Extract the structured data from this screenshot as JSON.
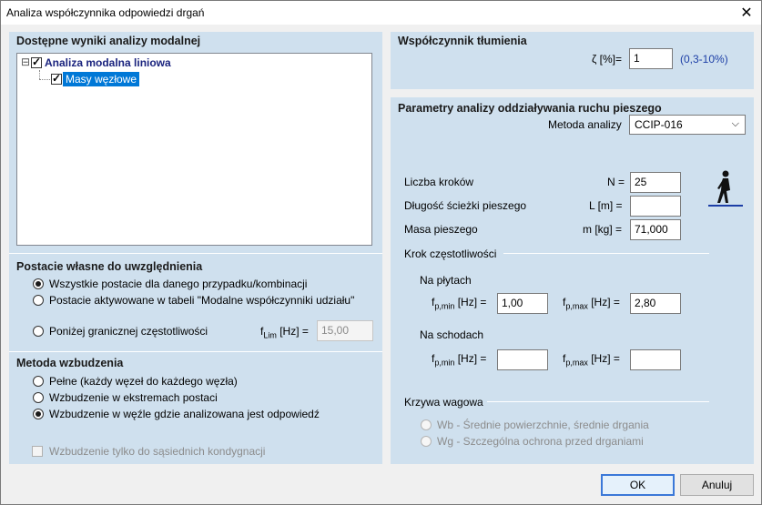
{
  "window": {
    "title": "Analiza współczynnika odpowiedzi drgań"
  },
  "results": {
    "title": "Dostępne wyniki analizy modalnej",
    "tree_expander": "⊟",
    "tree_root": "Analiza modalna liniowa",
    "tree_child": "Masy węzłowe"
  },
  "modes": {
    "title": "Postacie własne do uwzględnienia",
    "opt1": "Wszystkie postacie dla danego przypadku/kombinacji",
    "opt2": "Postacie aktywowane w tabeli \"Modalne współczynniki udziału\"",
    "opt3": "Poniżej granicznej częstotliwości",
    "flim_f": "f",
    "flim_sub": "Lim",
    "flim_unit": "[Hz] =",
    "flim_value": "15,00"
  },
  "excitation": {
    "title": "Metoda wzbudzenia",
    "opt1": "Pełne (każdy węzeł do każdego węzła)",
    "opt2": "Wzbudzenie w ekstremach postaci",
    "opt3": "Wzbudzenie w węźle gdzie analizowana jest odpowiedź",
    "adjacent": "Wzbudzenie tylko do sąsiednich kondygnacji"
  },
  "damping": {
    "title": "Współczynnik tłumienia",
    "label": "ζ [%]=",
    "value": "1",
    "range": "(0,3-10%)"
  },
  "pedestrian": {
    "title": "Parametry analizy oddziaływania ruchu pieszego",
    "method_label": "Metoda analizy",
    "method_value": "CCIP-016",
    "steps_label": "Liczba kroków",
    "steps_sym": "N =",
    "steps_value": "25",
    "path_label": "Długość ścieżki pieszego",
    "path_sym": "L [m] =",
    "path_value": "",
    "mass_label": "Masa pieszego",
    "mass_sym": "m [kg] =",
    "mass_value": "71,000",
    "freq_title": "Krok częstotliwości",
    "plates_title": "Na płytach",
    "stairs_title": "Na schodach",
    "f": "f",
    "sub_min": "p,min",
    "sub_max": "p,max",
    "unit": "[Hz] =",
    "plates_min": "1,00",
    "plates_max": "2,80",
    "stairs_min": "",
    "stairs_max": "",
    "weight_title": "Krzywa wagowa",
    "wb": "Wb - Średnie powierzchnie, średnie drgania",
    "wg": "Wg - Szczególna ochrona przed drganiami"
  },
  "buttons": {
    "ok": "OK",
    "cancel": "Anuluj"
  }
}
